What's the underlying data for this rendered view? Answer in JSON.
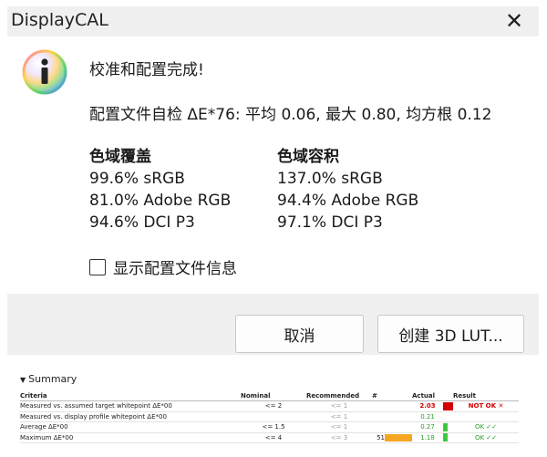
{
  "window": {
    "title": "DisplayCAL"
  },
  "message": {
    "headline": "校准和配置完成!",
    "delta_summary": "配置文件自检 ΔE*76: 平均 0.06, 最大 0.80, 均方根 0.12"
  },
  "gamut_coverage": {
    "header": "色域覆盖",
    "items": [
      "99.6% sRGB",
      "81.0% Adobe RGB",
      "94.6% DCI P3"
    ]
  },
  "gamut_volume": {
    "header": "色域容积",
    "items": [
      "137.0% sRGB",
      "94.4% Adobe RGB",
      "97.1% DCI P3"
    ]
  },
  "checkbox": {
    "label": "显示配置文件信息",
    "checked": false
  },
  "buttons": {
    "cancel": "取消",
    "create_3dlut": "创建 3D LUT..."
  },
  "summary": {
    "title": "Summary",
    "columns": {
      "criteria": "Criteria",
      "nominal": "Nominal",
      "recommended": "Recommended",
      "num": "#",
      "actual": "Actual",
      "result": "Result"
    },
    "rows": [
      {
        "criteria": "Measured vs. assumed target whitepoint ΔE*00",
        "nominal": "<= 2",
        "recommended": "<= 1",
        "num": "",
        "bar_fraction": 0,
        "bar_color": "#f5a623",
        "actual": "2.03",
        "marker_color": "#d40000",
        "result": "NOT OK ✕",
        "status": "bad"
      },
      {
        "criteria": "Measured vs. display profile whitepoint ΔE*00",
        "nominal": "",
        "recommended": "<= 1",
        "num": "",
        "bar_fraction": 0,
        "bar_color": "#f5a623",
        "actual": "0.21",
        "marker_color": "",
        "result": "",
        "status": "none"
      },
      {
        "criteria": "Average ΔE*00",
        "nominal": "<= 1.5",
        "recommended": "<= 1",
        "num": "",
        "bar_fraction": 0,
        "bar_color": "#f5a623",
        "actual": "0.27",
        "marker_color": "#3cc93c",
        "result": "OK ✓✓",
        "status": "ok"
      },
      {
        "criteria": "Maximum ΔE*00",
        "nominal": "<= 4",
        "recommended": "<= 3",
        "num": "51",
        "bar_fraction": 1,
        "bar_color": "#f5a623",
        "actual": "1.18",
        "marker_color": "#3cc93c",
        "result": "OK ✓✓",
        "status": "ok"
      }
    ]
  },
  "icons": {
    "info": "info-icon",
    "close": "close-icon",
    "collapse": "triangle-down-icon"
  }
}
